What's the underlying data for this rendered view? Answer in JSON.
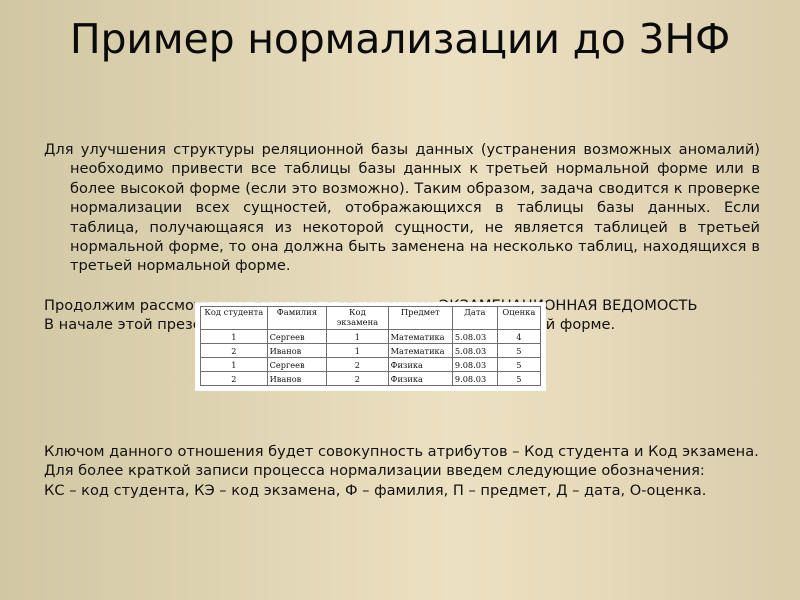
{
  "slide": {
    "title": "Пример нормализации до 3НФ",
    "background_left": "#d2c7a3",
    "background_center": "#ece0c2",
    "background_right": "#d9cdac",
    "text_color": "#121212"
  },
  "body": {
    "paragraph_1": "Для улучшения структуры реляционной базы данных (устранения возможных аномалий) необходимо привести все таблицы базы данных  к третьей нормальной форме или в более высокой форме (если это возможно). Таким образом, задача сводится к проверке нормализации всех сущностей, отображающихся в таблицы базы данных. Если таблица, получающаяся из некоторой сущности, не является таблицей в третьей нормальной форме, то она должна быть заменена на несколько таблиц, находящихся в третьей нормальной форме.",
    "paragraph_2": "Продолжим рассмотрение примера с отношением ЭКЗАМЕНАЦИОННАЯ ВЕДОМОСТЬ",
    "paragraph_3": "В начале этой презентации мы привели его в первой нормальной форме."
  },
  "bottom": {
    "paragraph_4": "Ключом данного отношения будет совокупность атрибутов – Код студента и Код экзамена.",
    "paragraph_5": "Для более краткой записи процесса нормализации введем следующие обозначения:",
    "paragraph_6": "КС – код студента, КЭ – код экзамена, Ф – фамилия, П – предмет, Д – дата, О-оценка."
  },
  "exam_table": {
    "caption": "ЭКЗАМЕНАЦИОННАЯ ВЕДОМОСТЬ",
    "headers": [
      "Код студента",
      "Фамилия",
      "Код экзамена",
      "Предмет",
      "Дата",
      "Оценка"
    ],
    "header_kod_ekzamena_line1": "Код",
    "header_kod_ekzamena_line2": "экзамена",
    "rows": [
      {
        "kod_studenta": "1",
        "familiya": "Сергеев",
        "kod_ekzamena": "1",
        "predmet": "Математика",
        "data": "5.08.03",
        "ocenka": "4"
      },
      {
        "kod_studenta": "2",
        "familiya": "Иванов",
        "kod_ekzamena": "1",
        "predmet": "Математика",
        "data": "5.08.03",
        "ocenka": "5"
      },
      {
        "kod_studenta": "1",
        "familiya": "Сергеев",
        "kod_ekzamena": "2",
        "predmet": "Физика",
        "data": "9.08.03",
        "ocenka": "5"
      },
      {
        "kod_studenta": "2",
        "familiya": "Иванов",
        "kod_ekzamena": "2",
        "predmet": "Физика",
        "data": "9.08.03",
        "ocenka": "5"
      }
    ]
  }
}
